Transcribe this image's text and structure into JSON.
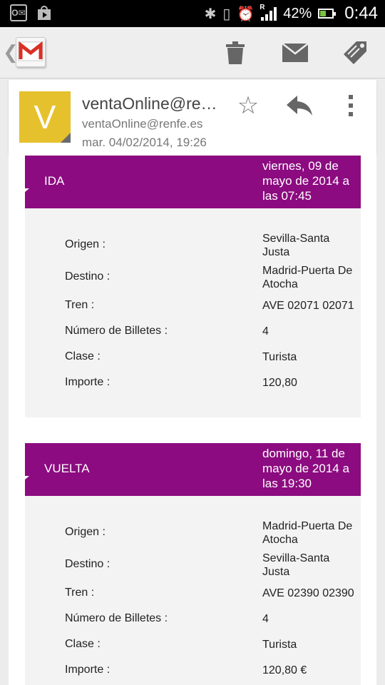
{
  "status_bar": {
    "left_icons": [
      "outlook-notification-icon",
      "play-store-notification-icon"
    ],
    "outlook_glyph": "O✉",
    "bluetooth_glyph": "✱",
    "vibrate_glyph": "▯",
    "alarm_glyph": "⏰",
    "signal_tag": "R",
    "battery_percent": "42%",
    "battery_level": 0.42,
    "time": "0:44"
  },
  "toolbar": {
    "icons": [
      "back-chevron-icon",
      "gmail-logo-icon",
      "trash-icon",
      "mail-icon",
      "label-icon"
    ],
    "back_glyph": "❮"
  },
  "message_header": {
    "avatar_letter": "V",
    "avatar_color": "#e6c12e",
    "sender_name": "ventaOnline@re…",
    "sender_email": "ventaOnline@renfe.es",
    "date": "mar. 04/02/2014, 19:26",
    "star_glyph": "☆"
  },
  "accent_color": "#8c0b80",
  "trips": [
    {
      "label": "IDA",
      "datetime": "viernes, 09 de mayo de 2014 a las 07:45",
      "rows": [
        {
          "label": "Origen :",
          "value": "Sevilla-Santa Justa"
        },
        {
          "label": "Destino :",
          "value": "Madrid-Puerta De Atocha"
        },
        {
          "label": "Tren :",
          "value": "AVE 02071 02071"
        },
        {
          "label": "Número de Billetes :",
          "value": "4"
        },
        {
          "label": "Clase :",
          "value": "Turista"
        },
        {
          "label": "Importe :",
          "value": "120,80"
        }
      ]
    },
    {
      "label": "VUELTA",
      "datetime": "domingo, 11 de mayo de 2014 a las 19:30",
      "rows": [
        {
          "label": "Origen :",
          "value": "Madrid-Puerta De Atocha"
        },
        {
          "label": "Destino :",
          "value": "Sevilla-Santa Justa"
        },
        {
          "label": "Tren :",
          "value": "AVE 02390 02390"
        },
        {
          "label": "Número de Billetes :",
          "value": "4"
        },
        {
          "label": "Clase :",
          "value": "Turista"
        },
        {
          "label": "Importe :",
          "value": "120,80 €"
        }
      ]
    }
  ]
}
